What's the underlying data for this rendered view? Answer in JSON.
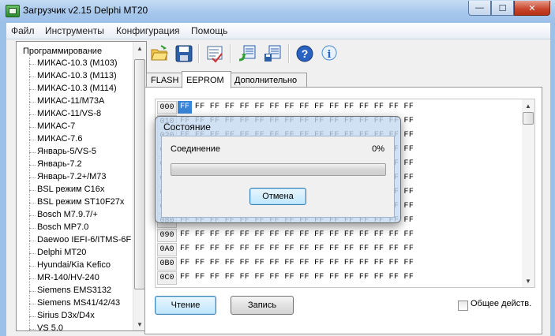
{
  "window": {
    "title": "Загрузчик v2.15 Delphi MT20",
    "minimize_glyph": "—",
    "maximize_glyph": "☐",
    "close_glyph": "✕"
  },
  "menu": [
    "Файл",
    "Инструменты",
    "Конфигурация",
    "Помощь"
  ],
  "tree": {
    "root": "Программирование",
    "items": [
      "МИКАС-10.3 (M103)",
      "МИКАС-10.3 (M113)",
      "МИКАС-10.3 (M114)",
      "МИКАС-11/M73A",
      "МИКАС-11/VS-8",
      "МИКАС-7",
      "МИКАС-7.6",
      "Январь-5/VS-5",
      "Январь-7.2",
      "Январь-7.2+/M73",
      "BSL режим C16x",
      "BSL режим ST10F27x",
      "Bosch M7.9.7/+",
      "Bosch MP7.0",
      "Daewoo IEFI-6/ITMS-6F",
      "Delphi MT20",
      "Hyundai/Kia Kefico",
      "MR-140/HV-240",
      "Siemens EMS3132",
      "Siemens MS41/42/43",
      "Sirius D3x/D4x",
      "VS 5.0"
    ]
  },
  "toolbar": {
    "icons": [
      "open-folder-icon",
      "save-disk-icon",
      "checklist-icon",
      "read-ecu-icon",
      "write-ecu-icon",
      "help-icon",
      "info-icon"
    ]
  },
  "tabs": [
    "FLASH",
    "EEPROM",
    "Дополнительно"
  ],
  "active_tab": "EEPROM",
  "hex": {
    "rows": [
      {
        "addr": "000",
        "bytes": "FF FF FF FF FF FF FF FF FF FF FF FF FF FF FF FF"
      },
      {
        "addr": "010",
        "bytes": "FF FF FF FF FF FF FF FF FF FF FF FF FF FF FF FF"
      },
      {
        "addr": "020",
        "bytes": "FF FF FF FF FF FF FF FF FF FF FF FF FF FF FF FF"
      },
      {
        "addr": "030",
        "bytes": "FF FF FF FF FF FF FF FF FF FF FF FF FF FF FF FF"
      },
      {
        "addr": "040",
        "bytes": "FF FF FF FF FF FF FF FF FF FF FF FF FF FF FF FF"
      },
      {
        "addr": "050",
        "bytes": "FF FF FF FF FF FF FF FF FF FF FF FF FF FF FF FF"
      },
      {
        "addr": "060",
        "bytes": "FF FF FF FF FF FF FF FF FF FF FF FF FF FF FF FF"
      },
      {
        "addr": "070",
        "bytes": "FF FF FF FF FF FF FF FF FF FF FF FF FF FF FF FF"
      },
      {
        "addr": "080",
        "bytes": "FF FF FF FF FF FF FF FF FF FF FF FF FF FF FF FF"
      },
      {
        "addr": "090",
        "bytes": "FF FF FF FF FF FF FF FF FF FF FF FF FF FF FF FF"
      },
      {
        "addr": "0A0",
        "bytes": "FF FF FF FF FF FF FF FF FF FF FF FF FF FF FF FF"
      },
      {
        "addr": "0B0",
        "bytes": "FF FF FF FF FF FF FF FF FF FF FF FF FF FF FF FF"
      },
      {
        "addr": "0C0",
        "bytes": "FF FF FF FF FF FF FF FF FF FF FF FF FF FF FF FF"
      }
    ],
    "selected_byte": "FF"
  },
  "buttons": {
    "read": "Чтение",
    "write": "Запись",
    "common_action": "Общее действ."
  },
  "dialog": {
    "title": "Состояние",
    "status": "Соединение",
    "percent": "0%",
    "progress": 0,
    "cancel": "Отмена"
  }
}
